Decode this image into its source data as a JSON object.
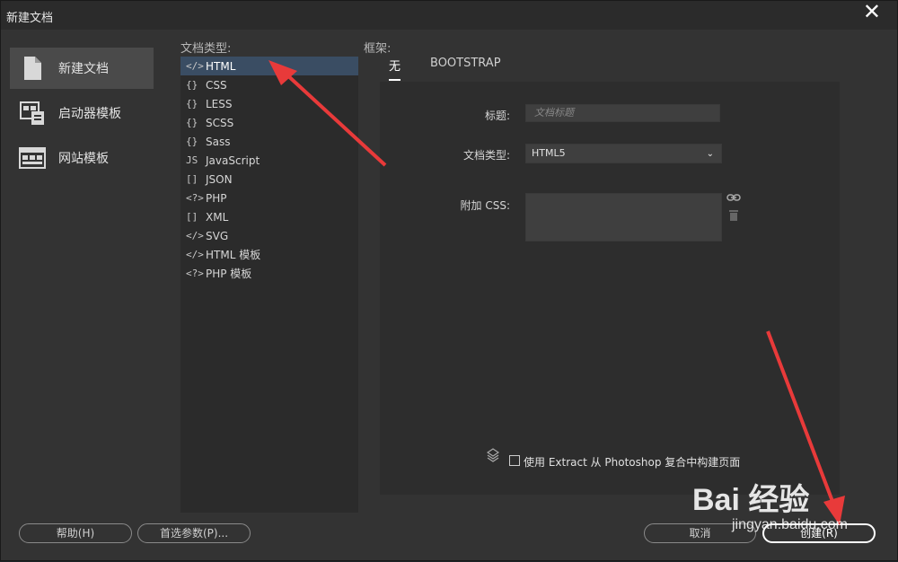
{
  "window": {
    "title": "新建文档",
    "close_glyph": "✕"
  },
  "categories": [
    {
      "label": "新建文档",
      "icon": "document-icon",
      "active": true
    },
    {
      "label": "启动器模板",
      "icon": "starter-template-icon",
      "active": false
    },
    {
      "label": "网站模板",
      "icon": "site-template-icon",
      "active": false
    }
  ],
  "doc_type": {
    "label": "文档类型:",
    "items": [
      {
        "icon": "</>",
        "label": "HTML",
        "selected": true
      },
      {
        "icon": "{}",
        "label": "CSS"
      },
      {
        "icon": "{}",
        "label": "LESS"
      },
      {
        "icon": "{}",
        "label": "SCSS"
      },
      {
        "icon": "{}",
        "label": "Sass"
      },
      {
        "icon": "JS",
        "label": "JavaScript"
      },
      {
        "icon": "[]",
        "label": "JSON"
      },
      {
        "icon": "<?>",
        "label": "PHP"
      },
      {
        "icon": "[]",
        "label": "XML"
      },
      {
        "icon": "</>",
        "label": "SVG"
      },
      {
        "icon": "</>",
        "label": "HTML 模板"
      },
      {
        "icon": "<?>",
        "label": "PHP 模板"
      }
    ]
  },
  "framework": {
    "label": "框架:",
    "tabs": [
      "无",
      "BOOTSTRAP"
    ],
    "title_label": "标题:",
    "title_placeholder": "文档标题",
    "doctype_label": "文档类型:",
    "doctype_value": "HTML5",
    "attach_css_label": "附加 CSS:",
    "extract_label": "使用 Extract 从 Photoshop 复合中构建页面"
  },
  "buttons": {
    "help": "帮助(H)",
    "prefs": "首选参数(P)...",
    "cancel": "取消",
    "create": "创建(R)"
  },
  "watermark": {
    "text": "Bai 经验",
    "url": "jingyan.baidu.com"
  },
  "colors": {
    "selected_row": "#3a4d63",
    "arrow": "#e83a3a"
  }
}
